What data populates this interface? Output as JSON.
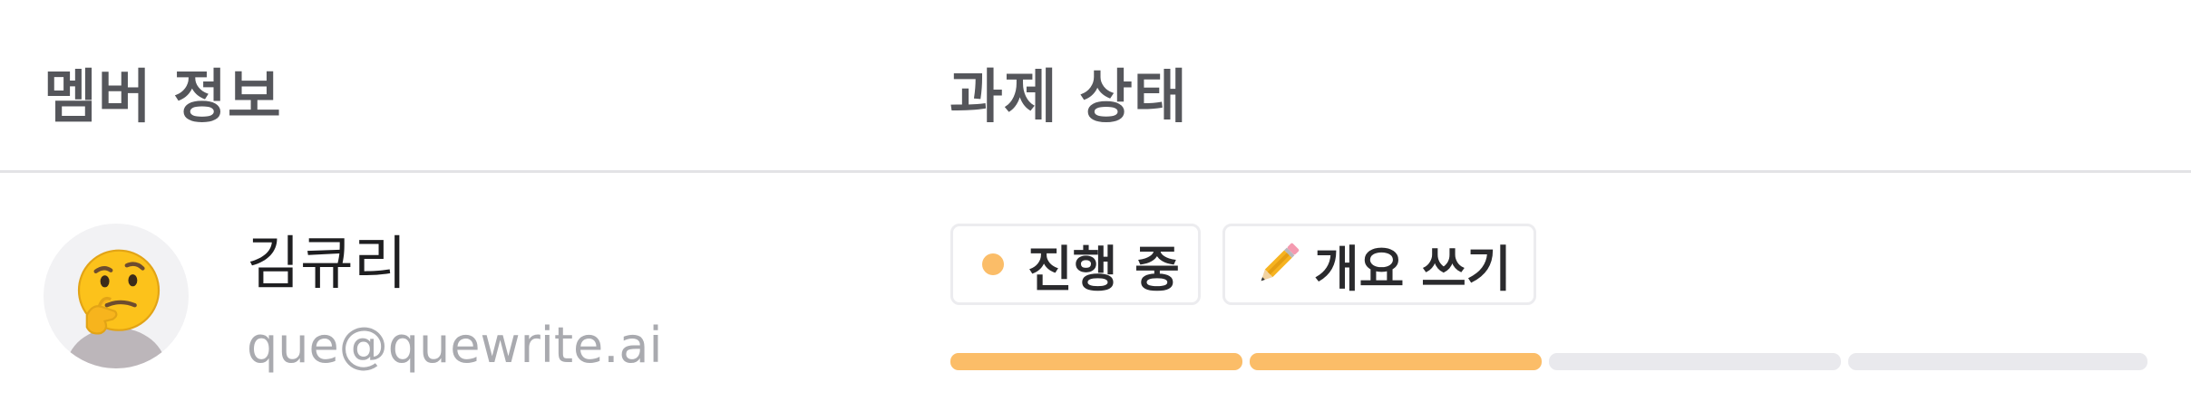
{
  "header": {
    "member_info": "멤버 정보",
    "task_status": "과제 상태"
  },
  "member": {
    "name": "김큐리",
    "email": "que@quewrite.ai",
    "avatar_icon": "thinking-face-emoji"
  },
  "status": {
    "progress_label": "진행 중",
    "progress_dot_color": "#fbbd68",
    "task_label": "개요 쓰기",
    "task_icon": "pencil-emoji",
    "steps_total": 4,
    "steps_completed": 2,
    "bar_done_color": "#fbbd68",
    "bar_todo_color": "#e9e9ed"
  }
}
